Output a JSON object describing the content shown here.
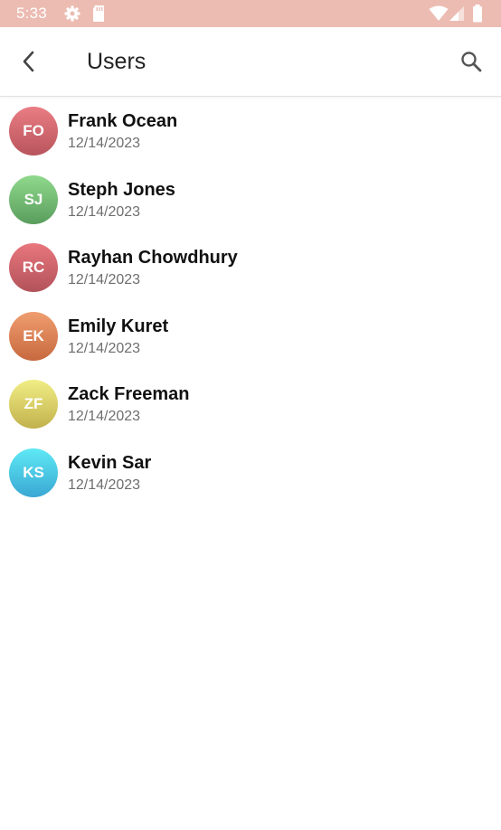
{
  "status_bar": {
    "time": "5:33",
    "background": "#ecbcb2",
    "icons": [
      "gear-icon",
      "sd-card-icon",
      "wifi-icon",
      "cell-signal-icon",
      "battery-icon"
    ]
  },
  "app_bar": {
    "title": "Users",
    "back_icon": "chevron-left-icon",
    "search_icon": "search-icon"
  },
  "users": [
    {
      "initials": "FO",
      "name": "Frank Ocean",
      "date": "12/14/2023",
      "color_top": "#ea7d84",
      "color_bottom": "#b9545c"
    },
    {
      "initials": "SJ",
      "name": "Steph Jones",
      "date": "12/14/2023",
      "color_top": "#8fd98c",
      "color_bottom": "#5a9d5d"
    },
    {
      "initials": "RC",
      "name": "Rayhan Chowdhury",
      "date": "12/14/2023",
      "color_top": "#e9767d",
      "color_bottom": "#b2525a"
    },
    {
      "initials": "EK",
      "name": "Emily Kuret",
      "date": "12/14/2023",
      "color_top": "#ef9d6f",
      "color_bottom": "#c7693f"
    },
    {
      "initials": "ZF",
      "name": "Zack Freeman",
      "date": "12/14/2023",
      "color_top": "#f1ee85",
      "color_bottom": "#c2b14c"
    },
    {
      "initials": "KS",
      "name": "Kevin Sar",
      "date": "12/14/2023",
      "color_top": "#5ee9f5",
      "color_bottom": "#3aa7d3"
    }
  ]
}
